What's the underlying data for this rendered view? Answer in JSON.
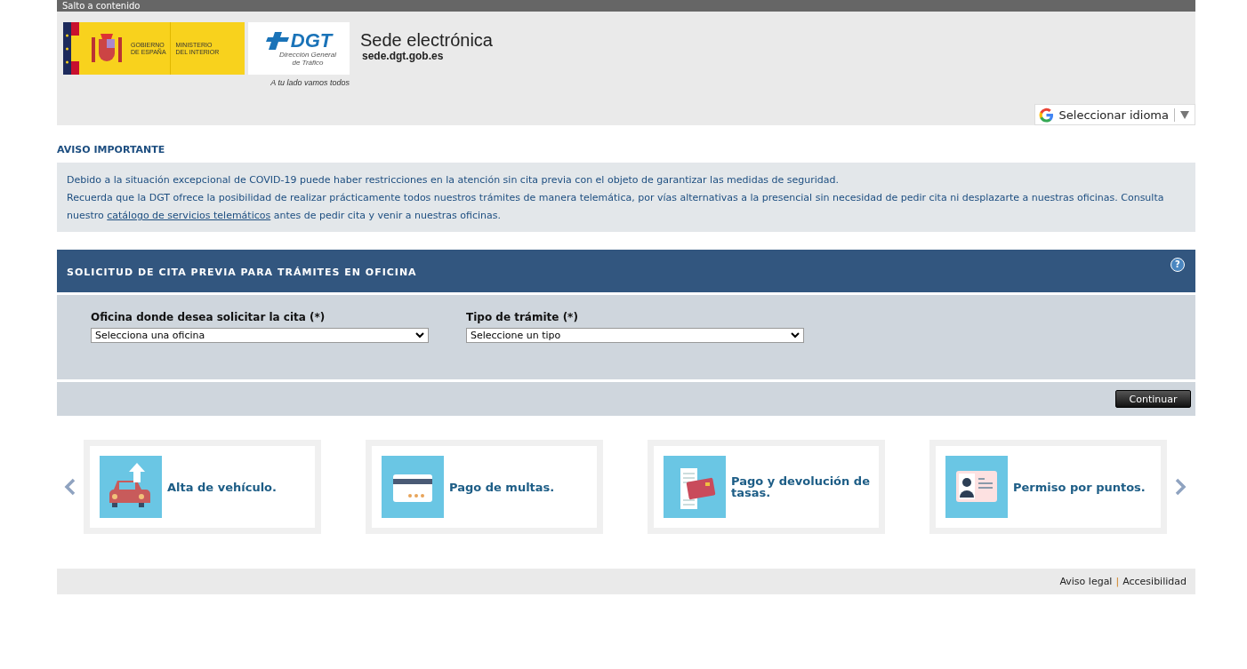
{
  "skip_link": "Salto a contenido",
  "header": {
    "gov_logo": {
      "line_1": [
        "GOBIERNO",
        "DE ESPAÑA"
      ],
      "line_2": [
        "MINISTERIO",
        "DEL INTERIOR"
      ]
    },
    "dgt_logo": {
      "mark": "DGT",
      "subtitle": [
        "Dirección General",
        "de Tráfico"
      ]
    },
    "tagline": "A tu lado vamos todos",
    "title": "Sede electrónica",
    "domain": "sede.dgt.gob.es",
    "language_selector": "Seleccionar idioma"
  },
  "notice": {
    "title": "AVISO IMPORTANTE",
    "line_1": "Debido a la situación excepcional de COVID-19 puede haber restricciones en la atención sin cita previa con el objeto de garantizar las medidas de seguridad.",
    "line_2_before": "Recuerda que la DGT ofrece la posibilidad de realizar prácticamente todos nuestros trámites de manera telemática, por vías alternativas a la presencial sin necesidad de pedir cita ni desplazarte a nuestras oficinas. Consulta nuestro",
    "line_2_link": "catálogo de servicios telemáticos",
    "line_2_after": "antes de pedir cita y venir a nuestras oficinas."
  },
  "form": {
    "title": "SOLICITUD DE CITA PREVIA PARA TRÁMITES EN OFICINA",
    "help": "?",
    "fields": [
      {
        "label": "Oficina donde desea solicitar la cita (*)",
        "value": "Selecciona una oficina"
      },
      {
        "label": "Tipo de trámite (*)",
        "value": "Seleccione un tipo"
      }
    ],
    "button": "Continuar"
  },
  "cards": [
    {
      "kind": "car",
      "label": "Alta de vehículo."
    },
    {
      "kind": "card",
      "label": "Pago de multas."
    },
    {
      "kind": "receipt",
      "label": "Pago y devolución de tasas."
    },
    {
      "kind": "id",
      "label": "Permiso por puntos."
    }
  ],
  "footer": {
    "links": [
      "Aviso legal",
      "Accesibilidad"
    ],
    "separator": "|"
  }
}
